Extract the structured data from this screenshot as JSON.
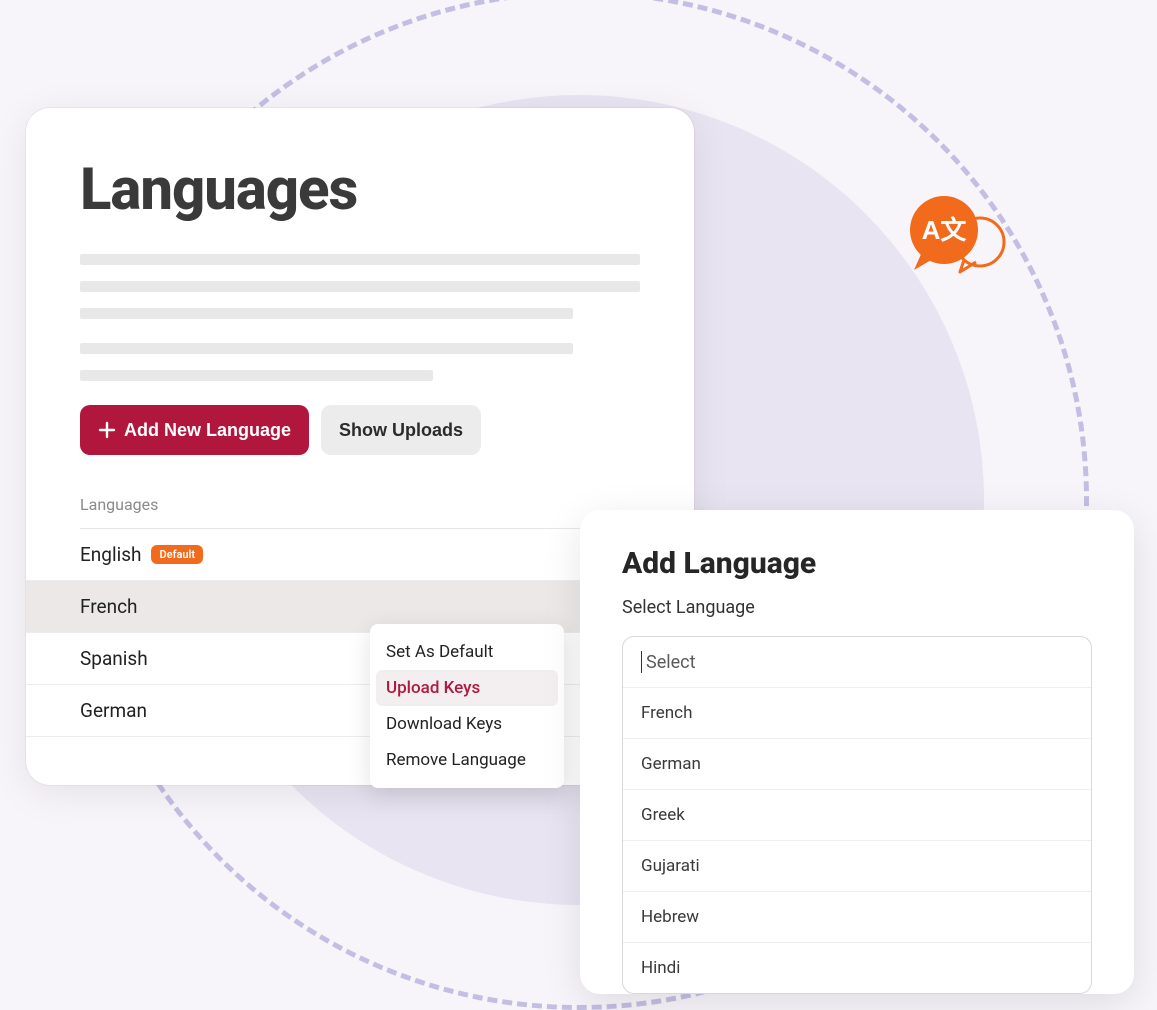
{
  "colors": {
    "primary": "#b1173c",
    "badge": "#f26a1b",
    "dashed": "#c3bfe3",
    "circleFill": "#e8e4f2"
  },
  "main": {
    "title": "Languages",
    "addButton": "Add New Language",
    "showUploads": "Show Uploads",
    "listHeader": "Languages",
    "defaultBadge": "Default",
    "rows": [
      {
        "name": "English",
        "default": true,
        "selected": false
      },
      {
        "name": "French",
        "default": false,
        "selected": true
      },
      {
        "name": "Spanish",
        "default": false,
        "selected": false
      },
      {
        "name": "German",
        "default": false,
        "selected": false
      }
    ]
  },
  "contextMenu": {
    "items": [
      {
        "label": "Set As Default",
        "active": false
      },
      {
        "label": "Upload Keys",
        "active": true
      },
      {
        "label": "Download Keys",
        "active": false
      },
      {
        "label": "Remove Language",
        "active": false
      }
    ]
  },
  "addPanel": {
    "title": "Add Language",
    "label": "Select Language",
    "placeholder": "Select",
    "options": [
      "French",
      "German",
      "Greek",
      "Gujarati",
      "Hebrew",
      "Hindi"
    ]
  }
}
